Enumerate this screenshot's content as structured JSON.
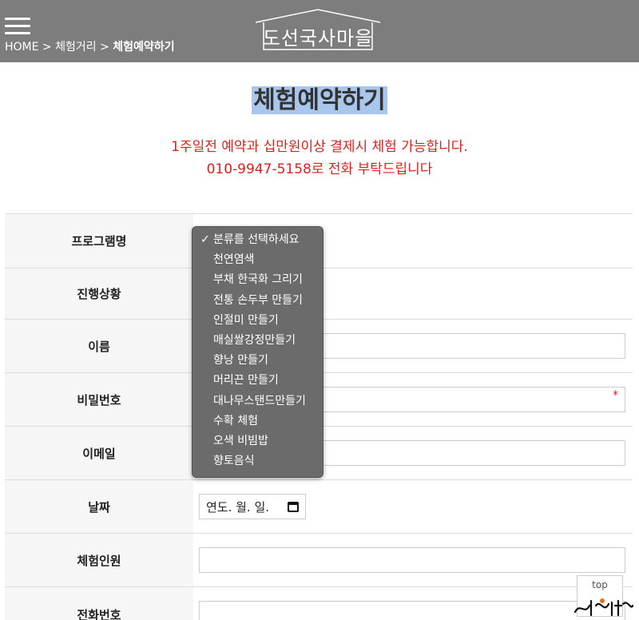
{
  "header": {
    "logo_text": "도선국사마을",
    "breadcrumb_home": "HOME",
    "breadcrumb_sep": " > ",
    "breadcrumb_parent": "체험거리",
    "breadcrumb_current": "체험예약하기"
  },
  "page": {
    "title": "체험예약하기",
    "notice_line1": "1주일전 예약과 십만원이상 결제시 체험 가능합니다.",
    "notice_line2": "010-9947-5158로 전화 부탁드립니다"
  },
  "form": {
    "program_label": "프로그램명",
    "status_label": "진행상황",
    "name_label": "이름",
    "password_label": "비밀번호",
    "password_required_mark": "*",
    "email_label": "이메일",
    "date_label": "날짜",
    "date_placeholder": "연도. 월. 일.",
    "people_label": "체험인원",
    "phone_label": "전화번호"
  },
  "dropdown": {
    "check_mark": "✓",
    "options": [
      "분류를 선택하세요",
      "천연염색",
      "부채 한국화 그리기",
      "전통 손두부 만들기",
      "인절미 만들기",
      "매실쌀강정만들기",
      "향낭 만들기",
      "머리끈 만들기",
      "대나무스탠드만들기",
      "수확 체험",
      "오색 비빔밥",
      "향토음식"
    ]
  },
  "top_button": {
    "label": "top"
  },
  "colors": {
    "header_bg": "#7d7d7d",
    "notice_red": "#e0201b",
    "title_highlight": "#a9c6ec"
  }
}
